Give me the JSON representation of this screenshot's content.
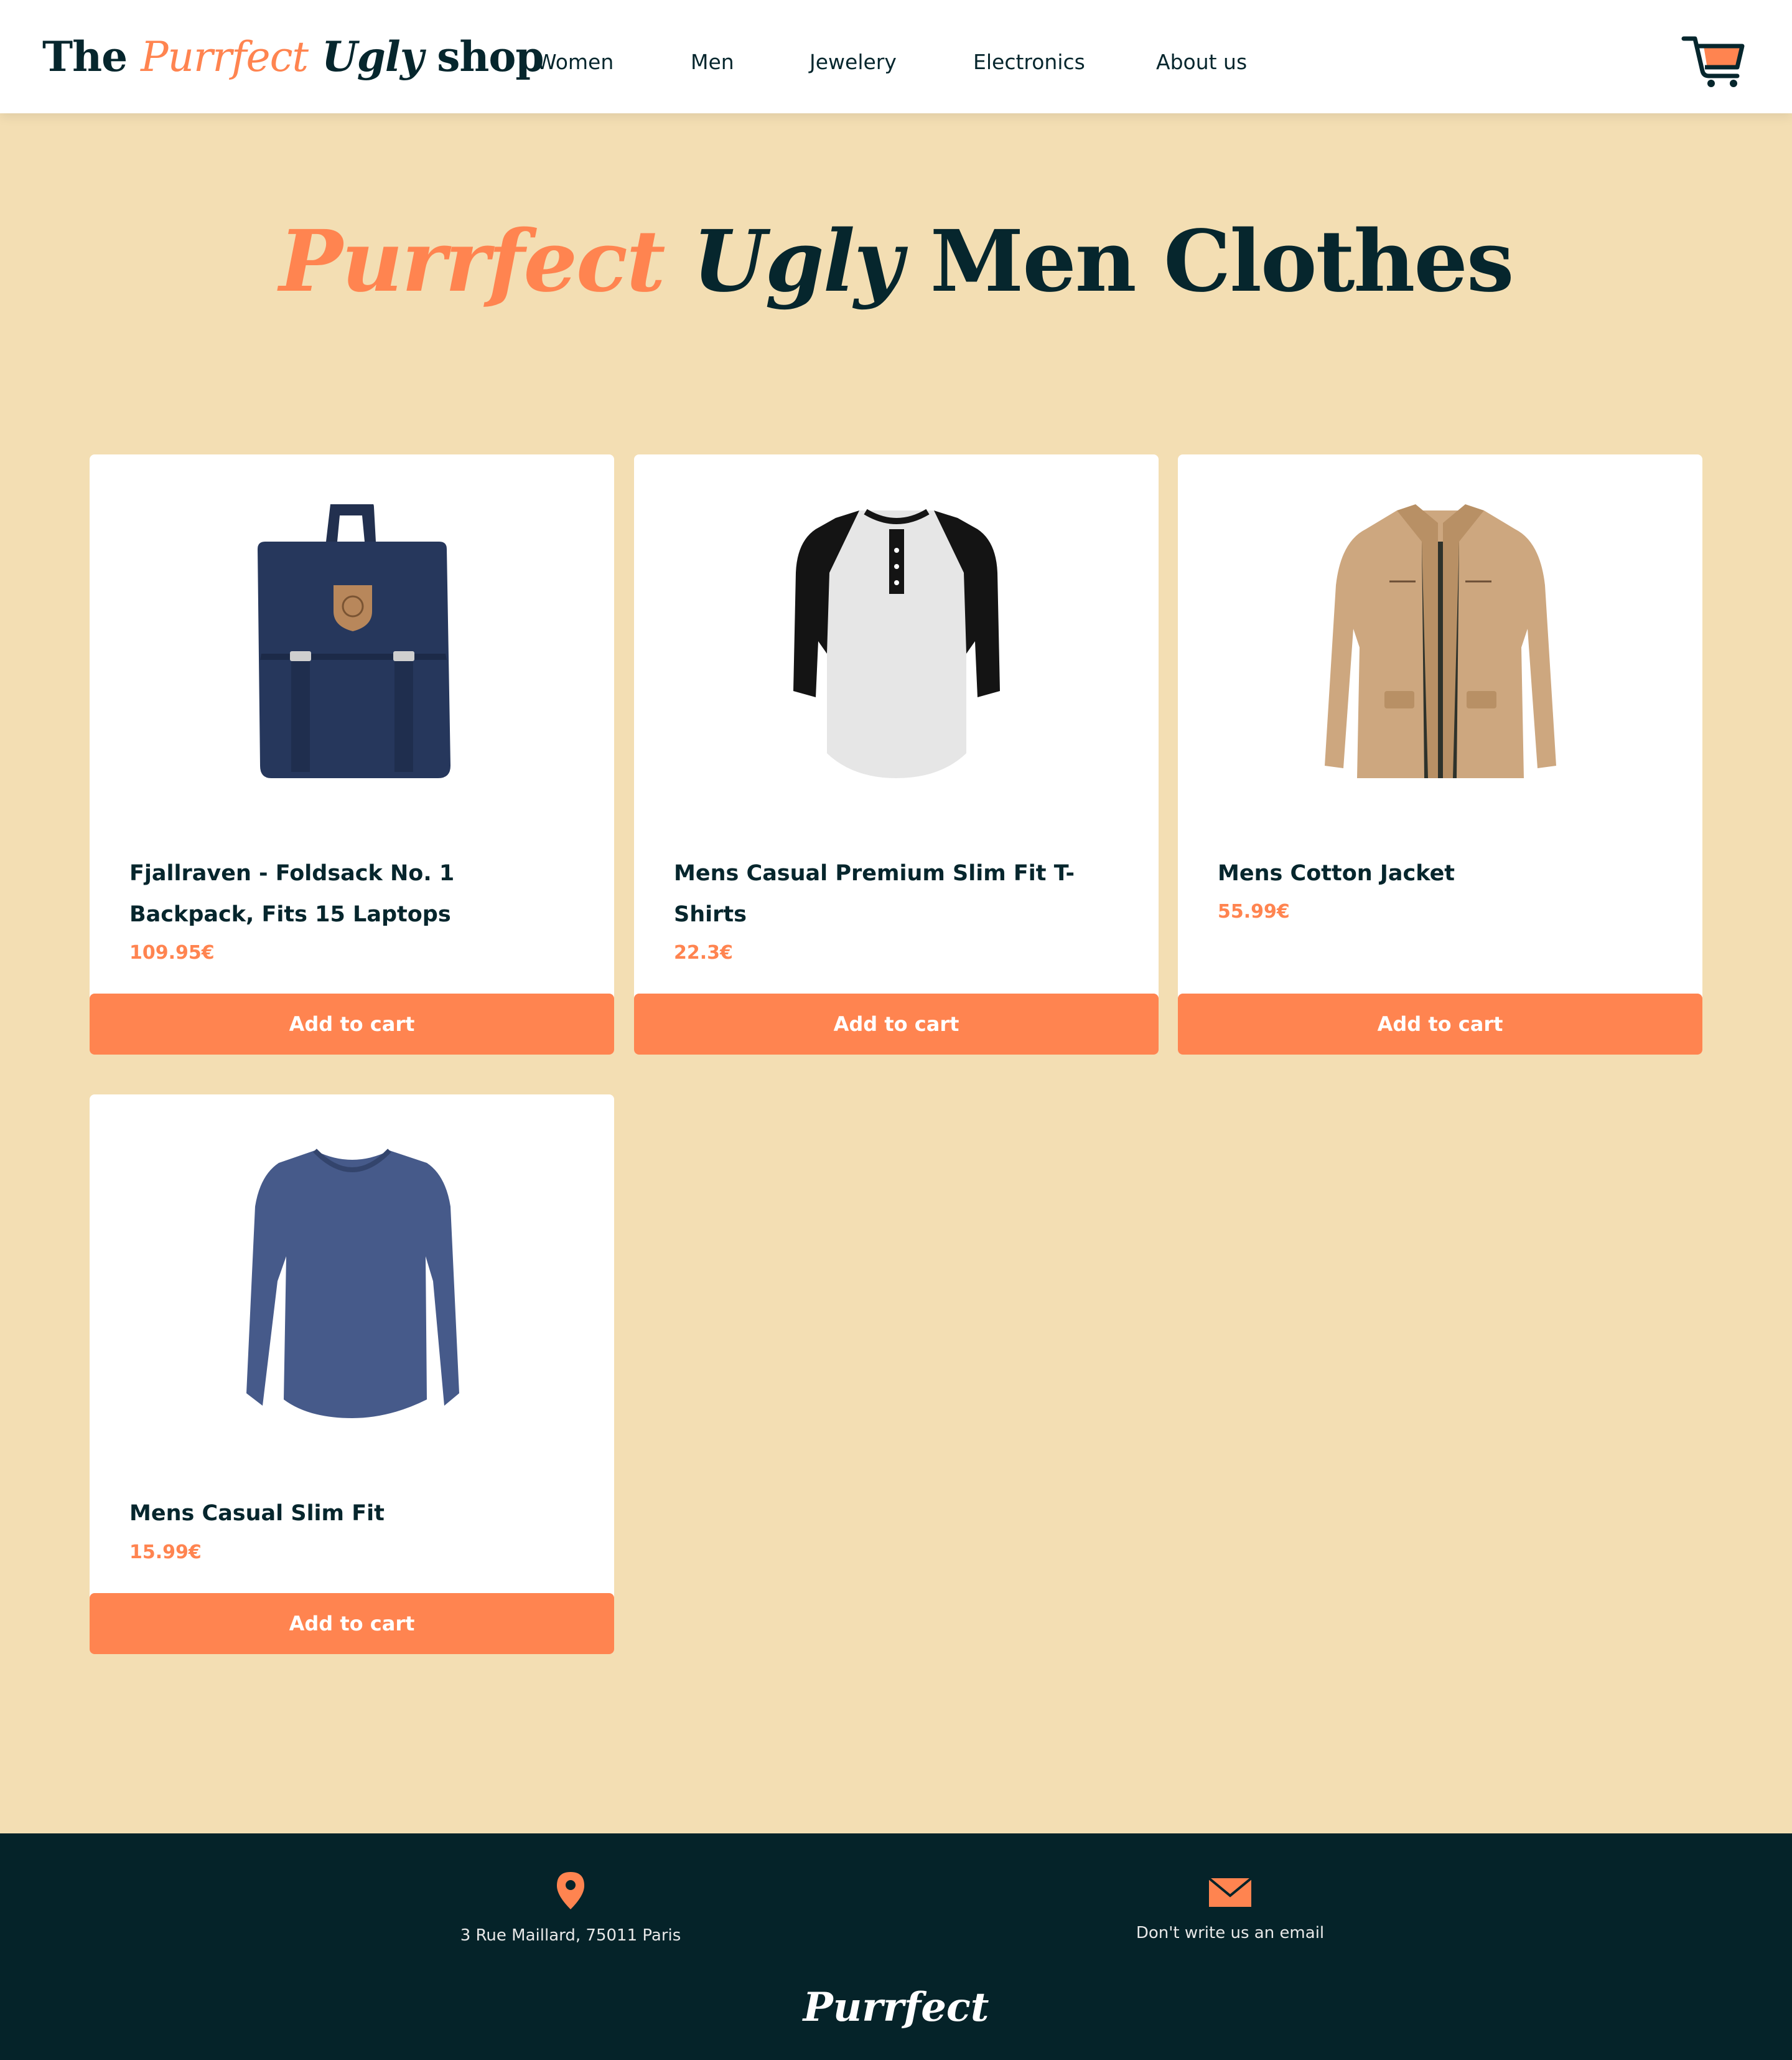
{
  "header": {
    "logo": {
      "part1": "The",
      "part2": "Purrfect",
      "part3": "Ugly",
      "part4": "shop"
    },
    "nav": [
      {
        "label": "Women"
      },
      {
        "label": "Men"
      },
      {
        "label": "Jewelery"
      },
      {
        "label": "Electronics"
      },
      {
        "label": "About us"
      }
    ],
    "cart_icon": "shopping-cart-icon"
  },
  "page": {
    "title_accent": "Purrfect",
    "title_ital": "Ugly",
    "title_rest": "Men Clothes"
  },
  "products": [
    {
      "title": "Fjallraven - Foldsack No. 1 Backpack, Fits 15 Laptops",
      "price": "109.95€",
      "button": "Add to cart",
      "image": "backpack"
    },
    {
      "title": "Mens Casual Premium Slim Fit T-Shirts",
      "price": "22.3€",
      "button": "Add to cart",
      "image": "raglan-tshirt"
    },
    {
      "title": "Mens Cotton Jacket",
      "price": "55.99€",
      "button": "Add to cart",
      "image": "jacket"
    },
    {
      "title": "Mens Casual Slim Fit",
      "price": "15.99€",
      "button": "Add to cart",
      "image": "long-sleeve-shirt"
    }
  ],
  "footer": {
    "address": "3 Rue Maillard, 75011 Paris",
    "address_icon": "location-pin-icon",
    "email": "Don't write us an email",
    "email_icon": "envelope-icon",
    "brand": "Purrfect"
  },
  "colors": {
    "accent": "#ff8450",
    "dark": "#06262d",
    "background": "#f3deb3",
    "footer": "#052329"
  }
}
